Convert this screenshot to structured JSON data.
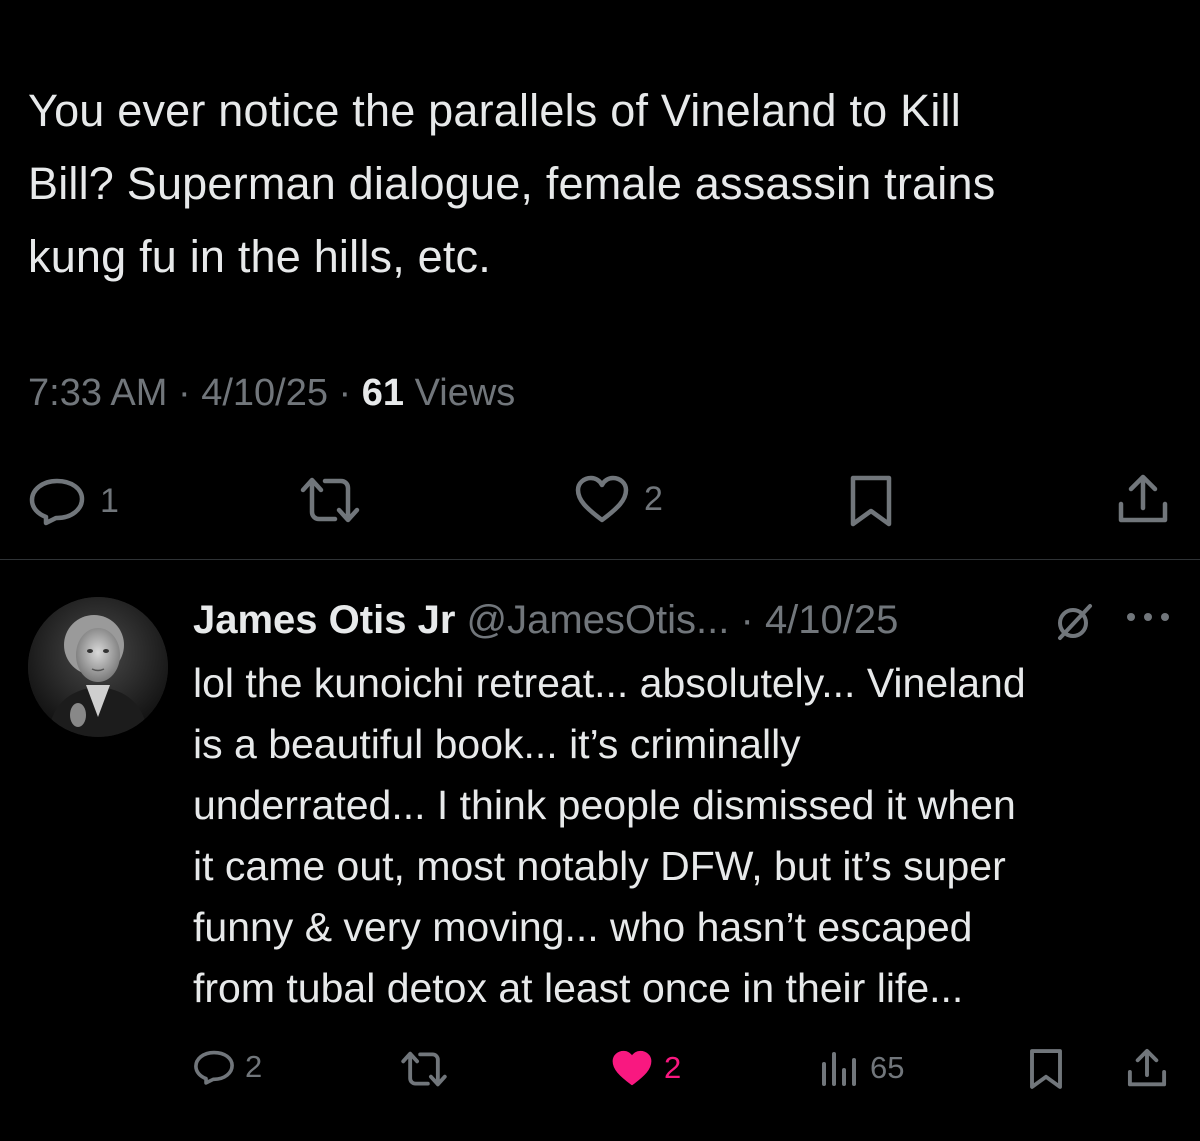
{
  "main_tweet": {
    "text_lines": [
      "You ever notice the parallels of Vineland to Kill",
      "Bill? Superman dialogue, female assassin trains",
      "kung fu in the hills, etc."
    ],
    "time": "7:33 AM",
    "separator": " · ",
    "date": "4/10/25",
    "views_count": "61",
    "views_label": " Views",
    "actions": {
      "reply_count": "1",
      "retweet_count": "",
      "like_count": "2"
    }
  },
  "reply": {
    "name": "James Otis Jr",
    "handle": "@JamesOtis...",
    "separator": " · ",
    "date": "4/10/25",
    "text_lines": [
      "lol the kunoichi retreat... absolutely... Vineland",
      "is a beautiful book... it’s criminally",
      "underrated... I think people dismissed it when",
      "it came out, most notably DFW, but it’s super",
      "funny & very moving... who hasn’t escaped",
      "from tubal detox at least once in their life..."
    ],
    "actions": {
      "reply_count": "2",
      "retweet_count": "",
      "like_count": "2",
      "views_count": "65"
    }
  },
  "colors": {
    "background": "#000000",
    "text": "#e7e9ea",
    "muted": "#71767b",
    "like_active": "#f91880",
    "divider": "#2f3336"
  },
  "icons": [
    "reply-icon",
    "retweet-icon",
    "heart-icon",
    "bookmark-icon",
    "share-icon",
    "grok-icon",
    "more-icon",
    "views-icon"
  ]
}
